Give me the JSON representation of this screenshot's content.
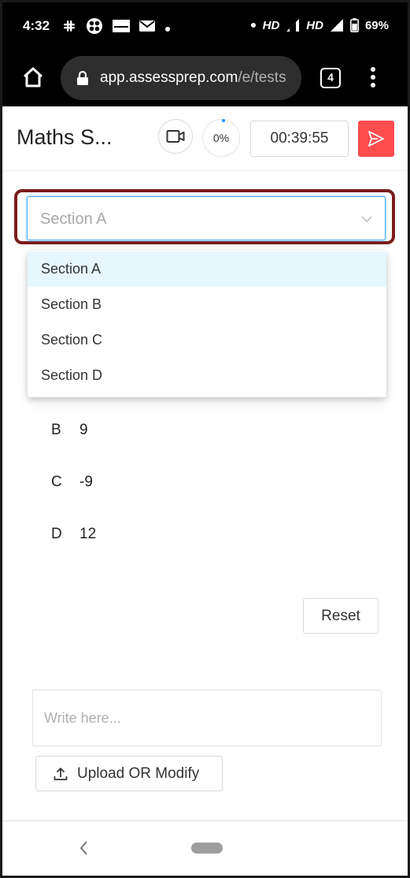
{
  "status_bar": {
    "time": "4:32",
    "network_1": "HD",
    "network_2": "HD",
    "battery": "69%"
  },
  "browser": {
    "url_host": "app.assessprep.com",
    "url_path": "/e/tests",
    "tab_count": "4"
  },
  "header": {
    "title": "Maths S...",
    "progress": "0%",
    "timer": "00:39:55",
    "accent_color": "#ff4d4f"
  },
  "section_select": {
    "selected": "Section A",
    "options": [
      "Section A",
      "Section B",
      "Section C",
      "Section D"
    ]
  },
  "question": {
    "options": [
      {
        "letter": "B",
        "value": "9"
      },
      {
        "letter": "C",
        "value": "-9"
      },
      {
        "letter": "D",
        "value": "12"
      }
    ],
    "reset_label": "Reset"
  },
  "answer": {
    "placeholder": "Write here...",
    "upload_label": "Upload OR Modify"
  }
}
